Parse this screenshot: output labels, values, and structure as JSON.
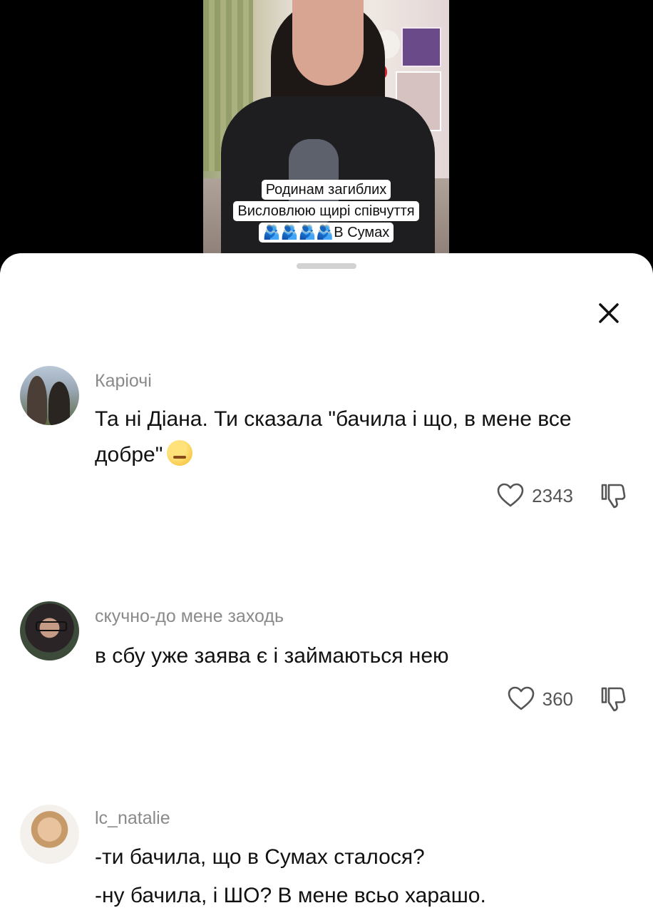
{
  "video": {
    "caption_lines": [
      "Родинам загиблих",
      "Висловлюю щирі співчуття",
      "🫂🫂🫂🫂В Сумах"
    ]
  },
  "comments": [
    {
      "username": "Каріочі",
      "text": "Та ні Діана. Ти сказала \"бачила і що, в мене все добре\"",
      "likes": "2343",
      "avatar_icon": "couple-photo-avatar"
    },
    {
      "username": "скучно-до мене заходь",
      "text": "в сбу уже заява є і займаються нею",
      "likes": "360",
      "avatar_icon": "girl-glasses-avatar"
    },
    {
      "username": "lc_natalie",
      "text_lines": [
        "-ти бачила, що в Сумах сталося?",
        "-ну бачила, і ШО? В мене всьо харашо."
      ],
      "avatar_icon": "woman-portrait-avatar"
    }
  ],
  "icons": {
    "close": "close-icon",
    "like": "heart-icon",
    "dislike": "thumbs-down-icon",
    "emoji": "smirking-face-emoji"
  }
}
